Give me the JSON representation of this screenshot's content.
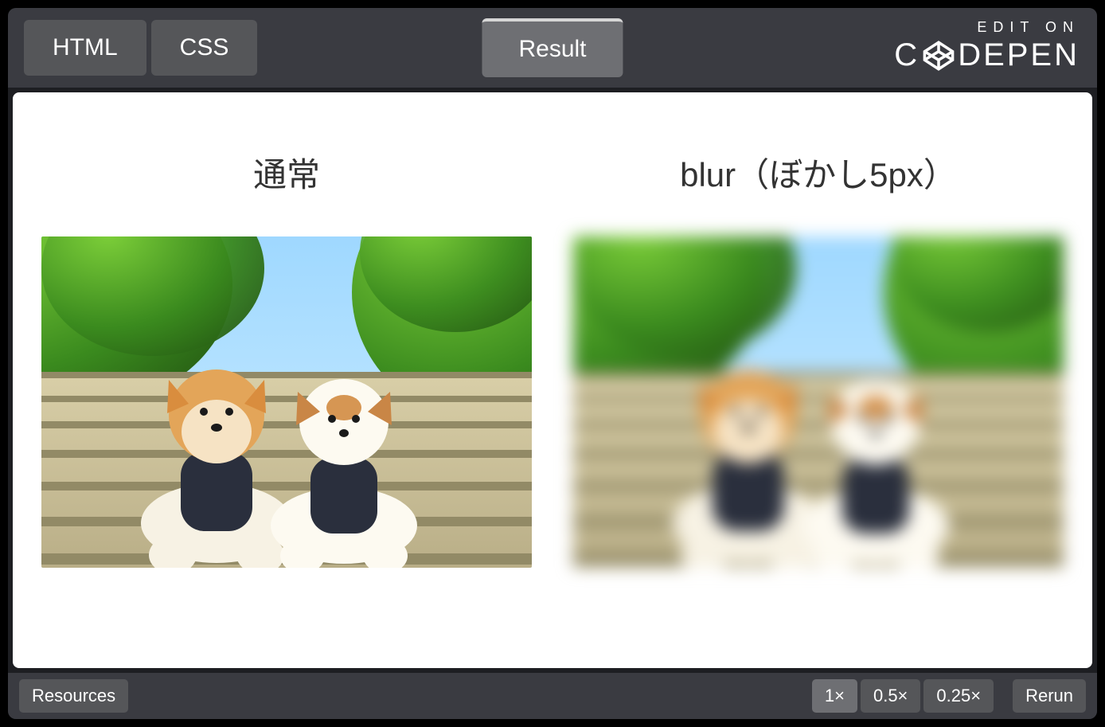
{
  "topbar": {
    "tabs": {
      "html": "HTML",
      "css": "CSS",
      "result": "Result"
    },
    "editOn": "EDIT ON",
    "brandPre": "C",
    "brandPost": "DEPEN"
  },
  "demo": {
    "left": {
      "title": "通常"
    },
    "right": {
      "title": "blur（ぼかし5px）"
    }
  },
  "bottombar": {
    "resources": "Resources",
    "zoom": {
      "x1": "1×",
      "x05": "0.5×",
      "x025": "0.25×"
    },
    "rerun": "Rerun"
  }
}
